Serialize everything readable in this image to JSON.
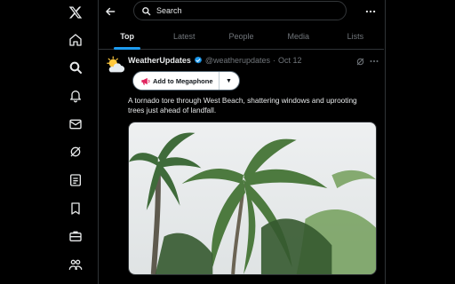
{
  "sidebar": {
    "items": [
      {
        "name": "x-logo-icon"
      },
      {
        "name": "home-icon"
      },
      {
        "name": "explore-icon"
      },
      {
        "name": "notifications-icon"
      },
      {
        "name": "messages-icon"
      },
      {
        "name": "grok-icon"
      },
      {
        "name": "lists-icon"
      },
      {
        "name": "bookmarks-icon"
      },
      {
        "name": "jobs-icon"
      },
      {
        "name": "communities-icon"
      }
    ]
  },
  "header": {
    "search_placeholder": "Search",
    "back_icon": "arrow-left-icon",
    "more_icon": "more-horizontal-icon"
  },
  "tabs": [
    {
      "label": "Top",
      "active": true
    },
    {
      "label": "Latest",
      "active": false
    },
    {
      "label": "People",
      "active": false
    },
    {
      "label": "Media",
      "active": false
    },
    {
      "label": "Lists",
      "active": false
    }
  ],
  "post": {
    "author_name": "WeatherUpdates",
    "handle": "@weatherupdates",
    "separator": "·",
    "date": "Oct 12",
    "verified": true,
    "megaphone_label": "Add to Megaphone",
    "megaphone_dropdown": "▼",
    "text": "A tornado tore through West Beach, shattering windows and uprooting trees just ahead of landfall.",
    "media_description_icon": "storm-palm-trees-image"
  },
  "colors": {
    "accent": "#1d9bf0",
    "background": "#000000",
    "text_primary": "#e7e9ea",
    "text_secondary": "#71767b",
    "border": "#2f3336"
  }
}
